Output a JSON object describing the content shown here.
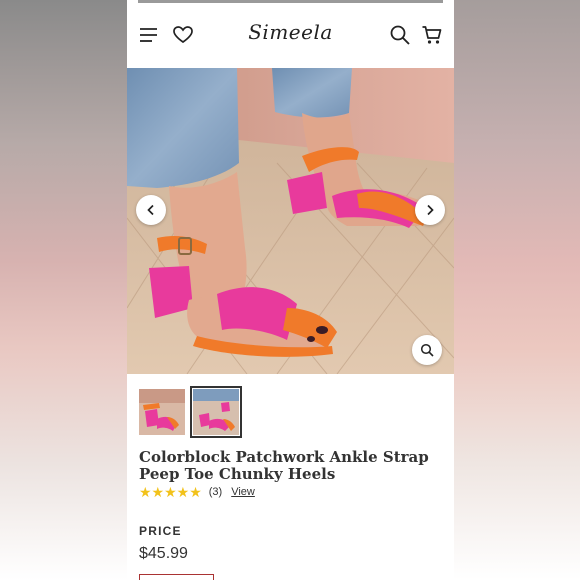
{
  "header": {
    "logo": "Simeela",
    "icons": [
      "menu-icon",
      "heart-icon",
      "search-icon",
      "cart-icon"
    ]
  },
  "gallery": {
    "prev_label": "Previous image",
    "next_label": "Next image",
    "thumbnail_count": 2,
    "active_thumbnail": 2
  },
  "product": {
    "title": "Colorblock Patchwork Ankle Strap Peep Toe Chunky Heels",
    "stars": "★★★★★",
    "rating_value": 5,
    "review_count": "(3)",
    "view_link": "View",
    "price_label": "PRICE",
    "price": "$45.99"
  },
  "colors": {
    "star": "#f2c21b",
    "text": "#333333",
    "shoe_pink": "#e83a9c",
    "shoe_orange": "#f07a2a"
  }
}
